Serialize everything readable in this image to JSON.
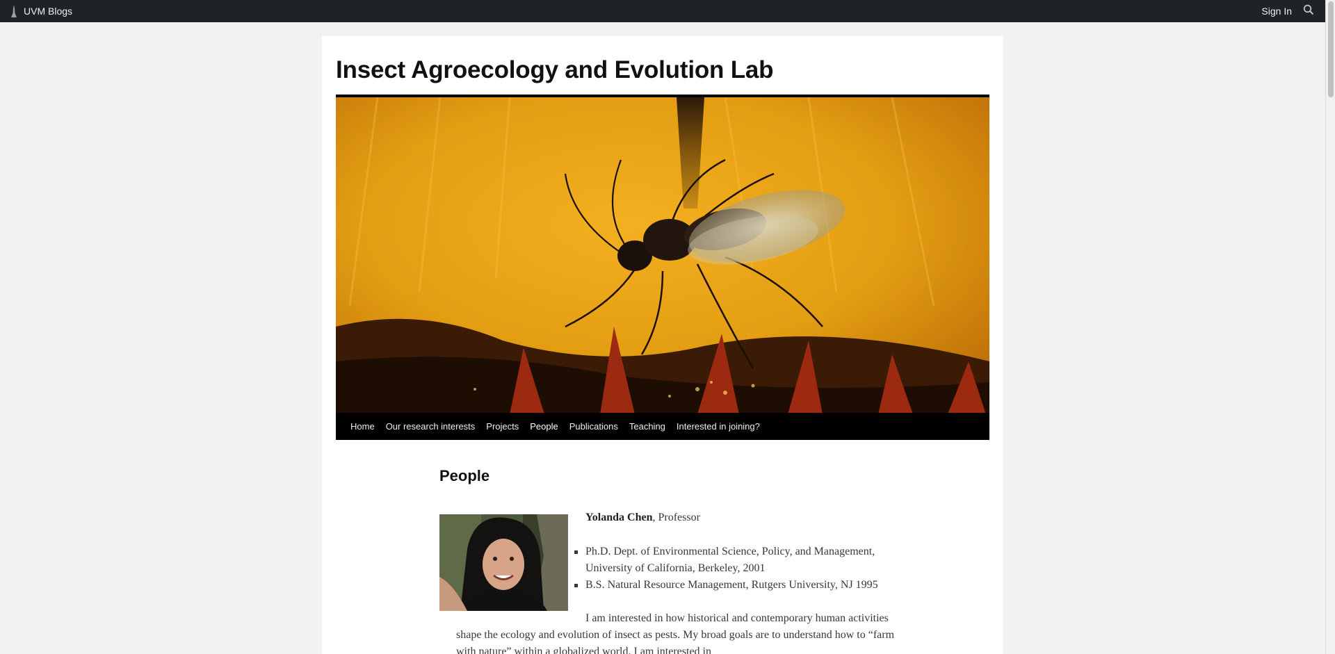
{
  "adminbar": {
    "brand_label": "UVM Blogs",
    "brand_icon": "uvm-tower-icon",
    "signin_label": "Sign In",
    "search_icon": "search-icon"
  },
  "site": {
    "title": "Insect Agroecology and Evolution Lab"
  },
  "nav": {
    "items": [
      {
        "label": "Home"
      },
      {
        "label": "Our research interests"
      },
      {
        "label": "Projects"
      },
      {
        "label": "People",
        "active": true
      },
      {
        "label": "Publications"
      },
      {
        "label": "Teaching"
      },
      {
        "label": "Interested in joining?"
      }
    ]
  },
  "entry": {
    "title": "People",
    "person": {
      "name": "Yolanda Chen",
      "role": ", Professor"
    },
    "degrees": [
      "Ph.D. Dept. of Environmental Science, Policy, and Management, University of California, Berkeley, 2001",
      "B.S. Natural Resource Management, Rutgers University, NJ 1995"
    ],
    "bio": "I am interested in how historical and contemporary human activities shape the ecology and evolution of insect as pests. My broad goals are to understand how to “farm with nature” within a globalized world. I am interested in"
  },
  "colors": {
    "adminbar_bg": "#1e2327",
    "nav_bg": "#000000",
    "page_bg": "#f1f1f1",
    "header_image_tone": "#e8a418"
  }
}
